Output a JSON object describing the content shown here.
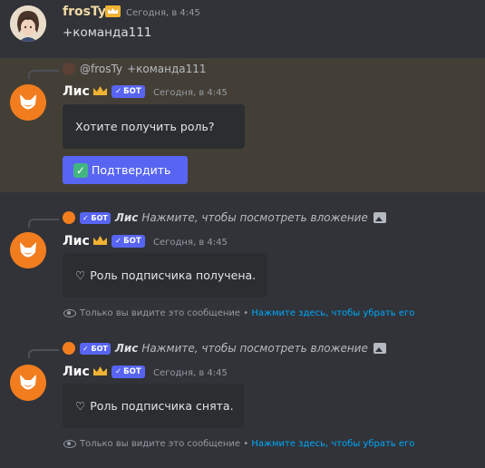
{
  "msg1": {
    "author": "frosTy",
    "timestamp": "Сегодня, в 4:45",
    "text": "+команда111"
  },
  "msg2": {
    "reply_mention": "@frosTy",
    "reply_text": "+команда111",
    "author": "Лис",
    "bot_tag": "БОТ",
    "timestamp": "Сегодня, в 4:45",
    "embed_text": "Хотите получить роль?",
    "button_emoji": "✓",
    "button_label": "Подтвердить"
  },
  "msg3": {
    "reply_bot_tag": "БОТ",
    "reply_name": "Лис",
    "reply_text": "Нажмите, чтобы посмотреть вложение",
    "author": "Лис",
    "bot_tag": "БОТ",
    "timestamp": "Сегодня, в 4:45",
    "embed_text": "Роль подписчика получена.",
    "ephemeral_text": "Только вы видите это сообщение •",
    "ephemeral_link": "Нажмите здесь, чтобы убрать его"
  },
  "msg4": {
    "reply_bot_tag": "БОТ",
    "reply_name": "Лис",
    "reply_text": "Нажмите, чтобы посмотреть вложение",
    "author": "Лис",
    "bot_tag": "БОТ",
    "timestamp": "Сегодня, в 4:45",
    "embed_text": "Роль подписчика снята.",
    "ephemeral_text": "Только вы видите это сообщение •",
    "ephemeral_link": "Нажмите здесь, чтобы убрать его"
  },
  "colors": {
    "background": "#313338",
    "highlight": "#443f36",
    "blurple": "#5865f2",
    "fox_orange": "#f27d1f",
    "link": "#00a8fc"
  },
  "icons": [
    "crown-icon",
    "fox-avatar-icon",
    "check-icon",
    "heart-icon",
    "image-icon",
    "eye-icon"
  ]
}
